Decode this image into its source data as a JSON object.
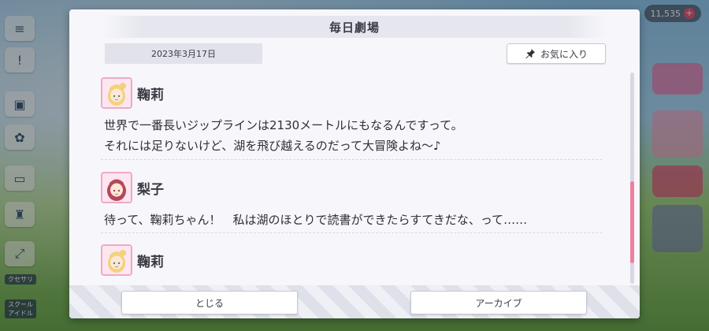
{
  "background": {
    "coins": "11,535",
    "left_menu_labels": [
      "クセサリ",
      "スクール アイドル"
    ]
  },
  "dialog": {
    "title": "毎日劇場",
    "date": "2023年3月17日",
    "favorite_label": "お気に入り",
    "entries": [
      {
        "speaker": "鞠莉",
        "lines": [
          "世界で一番長いジップラインは2130メートルにもなるんですって。",
          "それには足りないけど、湖を飛び越えるのだって大冒険よね～♪"
        ]
      },
      {
        "speaker": "梨子",
        "lines": [
          "待って、鞠莉ちゃん！　私は湖のほとりで読書ができたらすてきだな、って……"
        ]
      },
      {
        "speaker": "鞠莉",
        "lines": []
      }
    ],
    "close_label": "とじる",
    "archive_label": "アーカイブ"
  },
  "colors": {
    "accent": "#ee7fa0",
    "avatar_border": "#f0a9c5",
    "title_bar": "#e6e7ee"
  }
}
